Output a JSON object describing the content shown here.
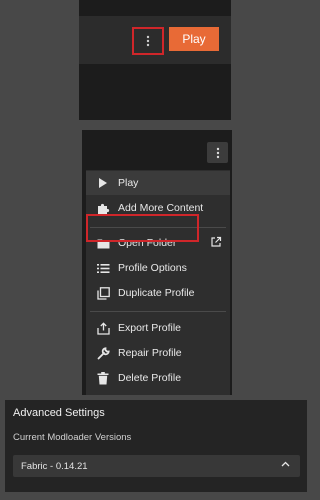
{
  "launcher": {
    "play_label": "Play"
  },
  "context_menu": {
    "items": [
      {
        "label": "Play",
        "icon": "play-icon"
      },
      {
        "label": "Add More Content",
        "icon": "puzzle-icon"
      },
      {
        "label": "Open Folder",
        "icon": "folder-icon"
      },
      {
        "label": "Profile Options",
        "icon": "list-icon"
      },
      {
        "label": "Duplicate Profile",
        "icon": "duplicate-icon"
      },
      {
        "label": "Export Profile",
        "icon": "export-icon"
      },
      {
        "label": "Repair Profile",
        "icon": "wrench-icon"
      },
      {
        "label": "Delete Profile",
        "icon": "trash-icon"
      }
    ]
  },
  "advanced_settings": {
    "title": "Advanced Settings",
    "subtitle": "Current Modloader Versions",
    "selected_version": "Fabric - 0.14.21"
  },
  "colors": {
    "accent": "#e86a36",
    "highlight": "#d0262a"
  }
}
